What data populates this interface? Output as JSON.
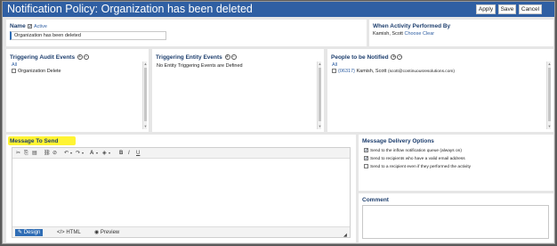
{
  "header": {
    "title": "Notification Policy: Organization has been deleted",
    "buttons": {
      "apply": "Apply",
      "save": "Save",
      "cancel": "Cancel"
    }
  },
  "name_section": {
    "label": "Name",
    "active_label": "Active",
    "active_checked": true,
    "value": "Organization has been deleted"
  },
  "when_section": {
    "label": "When Activity Performed By",
    "person": "Kamish, Scott",
    "choose_link": "Choose",
    "clear_link": "Clear"
  },
  "audit_events": {
    "label": "Triggering Audit Events",
    "all_link": "All",
    "items": [
      {
        "label": "Organization Delete",
        "checked": false
      }
    ]
  },
  "entity_events": {
    "label": "Triggering Entity Events",
    "empty_text": "No Entity Triggering Events are Defined"
  },
  "people": {
    "label": "People to be Notified",
    "all_link": "All",
    "items": [
      {
        "id": "{06317}",
        "name": "Kamish, Scott",
        "email": "(scott@continuousresolutions.com)",
        "checked": false
      }
    ]
  },
  "message": {
    "label": "Message To Send",
    "tabs": {
      "design": "Design",
      "html": "HTML",
      "preview": "Preview"
    },
    "active_tab": "Design"
  },
  "delivery": {
    "label": "Message Delivery Options",
    "options": [
      {
        "label": "Send to the inflow notification queue (always on)",
        "checked": true
      },
      {
        "label": "Send to recipients who have a valid email address",
        "checked": true
      },
      {
        "label": "Send to a recipient even if they performed the activity",
        "checked": false
      }
    ]
  },
  "comment": {
    "label": "Comment"
  },
  "colors": {
    "header": "#2f5fa3",
    "accent": "#2f6db5",
    "highlight": "#fff100",
    "label": "#1e3f6e"
  }
}
